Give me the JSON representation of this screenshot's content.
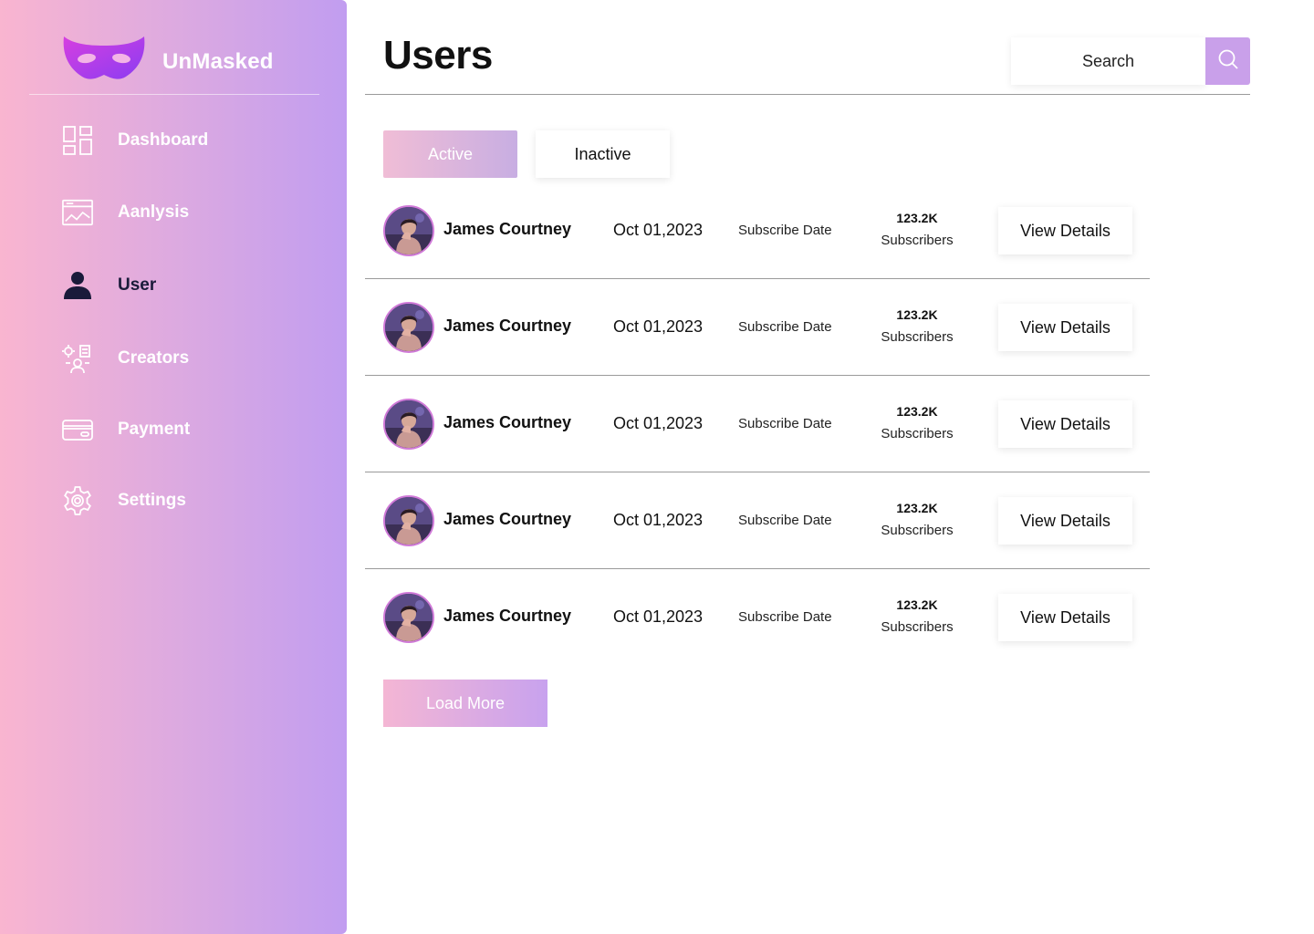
{
  "brand": {
    "name": "UnMasked",
    "logo_icon": "mask-icon"
  },
  "sidebar": {
    "items": [
      {
        "label": "Dashboard",
        "icon": "dashboard-grid-icon",
        "active": false
      },
      {
        "label": "Aanlysis",
        "icon": "analysis-chart-icon",
        "active": false
      },
      {
        "label": "User",
        "icon": "user-icon",
        "active": true
      },
      {
        "label": "Creators",
        "icon": "creators-icon",
        "active": false
      },
      {
        "label": "Payment",
        "icon": "credit-card-icon",
        "active": false
      },
      {
        "label": "Settings",
        "icon": "gear-icon",
        "active": false
      }
    ]
  },
  "header": {
    "title": "Users",
    "search_label": "Search",
    "search_icon": "search-icon"
  },
  "tabs": [
    {
      "label": "Active",
      "selected": true
    },
    {
      "label": "Inactive",
      "selected": false
    }
  ],
  "users": [
    {
      "name": "James Courtney",
      "date": "Oct 01,2023",
      "date_label": "Subscribe Date",
      "subscribers": "123.2K",
      "subscribers_label": "Subscribers",
      "action": "View Details"
    },
    {
      "name": "James Courtney",
      "date": "Oct 01,2023",
      "date_label": "Subscribe Date",
      "subscribers": "123.2K",
      "subscribers_label": "Subscribers",
      "action": "View Details"
    },
    {
      "name": "James Courtney",
      "date": "Oct 01,2023",
      "date_label": "Subscribe Date",
      "subscribers": "123.2K",
      "subscribers_label": "Subscribers",
      "action": "View Details"
    },
    {
      "name": "James Courtney",
      "date": "Oct 01,2023",
      "date_label": "Subscribe Date",
      "subscribers": "123.2K",
      "subscribers_label": "Subscribers",
      "action": "View Details"
    },
    {
      "name": "James Courtney",
      "date": "Oct 01,2023",
      "date_label": "Subscribe Date",
      "subscribers": "123.2K",
      "subscribers_label": "Subscribers",
      "action": "View Details"
    }
  ],
  "load_more_label": "Load More",
  "colors": {
    "sidebar_start": "#f9b5d0",
    "sidebar_end": "#c19df0",
    "accent": "#c9a0ea",
    "active_nav_text": "#1a1a3a",
    "mask_start": "#d042e0",
    "mask_end": "#8e3df0"
  }
}
